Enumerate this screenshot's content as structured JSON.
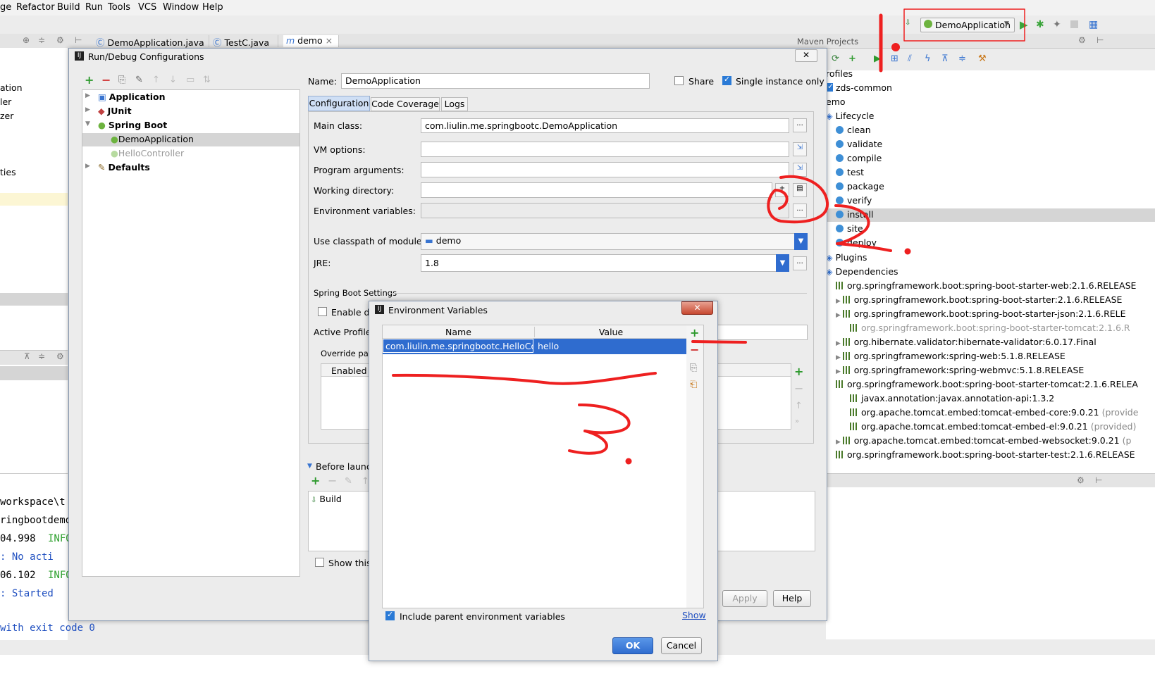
{
  "menu": [
    "ge",
    "Refactor",
    "Build",
    "Run",
    "Tools",
    "VCS",
    "Window",
    "Help"
  ],
  "toolbar": {
    "run_config": "DemoApplication"
  },
  "editor_tabs": [
    "DemoApplication.java",
    "TestC.java",
    "demo"
  ],
  "left_partial": [
    "ation",
    "ler",
    "zer",
    "ties"
  ],
  "console": {
    "lines": [
      "workspace\\t",
      "ringbootdemo",
      "04.998",
      "INFO",
      "  : No acti",
      "06.102",
      "INFO",
      "  : Started",
      "with exit code 0"
    ]
  },
  "maven": {
    "title": "Maven Projects",
    "rows": [
      "rofiles",
      "zds-common",
      "emo",
      "Lifecycle",
      "clean",
      "validate",
      "compile",
      "test",
      "package",
      "verify",
      "install",
      "site",
      "deploy",
      "Plugins",
      "Dependencies",
      "org.springframework.boot:spring-boot-starter-web:2.1.6.RELEASE",
      "org.springframework.boot:spring-boot-starter:2.1.6.RELEASE",
      "org.springframework.boot:spring-boot-starter-json:2.1.6.RELE",
      "org.springframework.boot:spring-boot-starter-tomcat:2.1.6.R",
      "org.hibernate.validator:hibernate-validator:6.0.17.Final",
      "org.springframework:spring-web:5.1.8.RELEASE",
      "org.springframework:spring-webmvc:5.1.8.RELEASE",
      "org.springframework.boot:spring-boot-starter-tomcat:2.1.6.RELEA",
      "javax.annotation:javax.annotation-api:1.3.2",
      "org.apache.tomcat.embed:tomcat-embed-core:9.0.21",
      "(provide",
      "org.apache.tomcat.embed:tomcat-embed-el:9.0.21",
      "(provided)",
      "org.apache.tomcat.embed:tomcat-embed-websocket:9.0.21",
      "(p",
      "org.springframework.boot:spring-boot-starter-test:2.1.6.RELEASE"
    ]
  },
  "dialog": {
    "title": "Run/Debug Configurations",
    "tree": [
      "Application",
      "JUnit",
      "Spring Boot",
      "DemoApplication",
      "HelloController",
      "Defaults"
    ],
    "name_label": "Name:",
    "name_value": "DemoApplication",
    "share": "Share",
    "single_instance": "Single instance only",
    "tabs": [
      "Configuration",
      "Code Coverage",
      "Logs"
    ],
    "main_class_label": "Main class:",
    "main_class": "com.liulin.me.springbootc.DemoApplication",
    "vm_label": "VM options:",
    "prog_label": "Program arguments:",
    "workdir_label": "Working directory:",
    "env_label": "Environment variables:",
    "module_label": "Use classpath of module:",
    "module": "demo",
    "jre_label": "JRE:",
    "jre": "1.8",
    "sb_settings": "Spring Boot Settings",
    "enable_debug": "Enable de",
    "active_profiles": "Active Profiles",
    "override": "Override para",
    "enabled_col": "Enabled",
    "before_launch": "Before launch:",
    "build": "Build",
    "show_this": "Show this",
    "apply": "Apply",
    "help": "Help"
  },
  "env_dialog": {
    "title": "Environment Variables",
    "col_name": "Name",
    "col_value": "Value",
    "row_name": "com.liulin.me.springbootc.HelloCon...",
    "row_value": "hello",
    "include_parent": "Include parent environment variables",
    "show": "Show",
    "ok": "OK",
    "cancel": "Cancel"
  },
  "colors": {
    "accent": "#3874d0",
    "annotation": "#ee2020",
    "tree_selected": "#d5d5d5"
  }
}
